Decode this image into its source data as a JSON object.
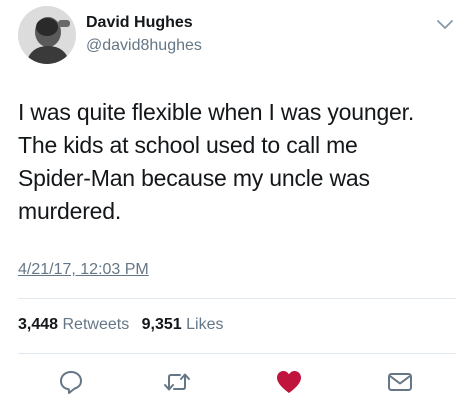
{
  "user": {
    "display_name": "David Hughes",
    "handle": "@david8hughes"
  },
  "tweet": {
    "text": "I was quite flexible when I was younger.\nThe kids at school used to call me\nSpider-Man because my uncle was\nmurdered.",
    "timestamp": "4/21/17, 12:03 PM"
  },
  "stats": {
    "retweets_count": "3,448",
    "retweets_label": "Retweets",
    "likes_count": "9,351",
    "likes_label": "Likes"
  },
  "icons": {
    "menu": "chevron-down-icon",
    "reply": "reply-icon",
    "retweet": "retweet-icon",
    "like": "heart-icon",
    "dm": "envelope-icon"
  },
  "colors": {
    "text": "#14171a",
    "secondary": "#657786",
    "like_active": "#e0245e",
    "icon": "#657786"
  }
}
